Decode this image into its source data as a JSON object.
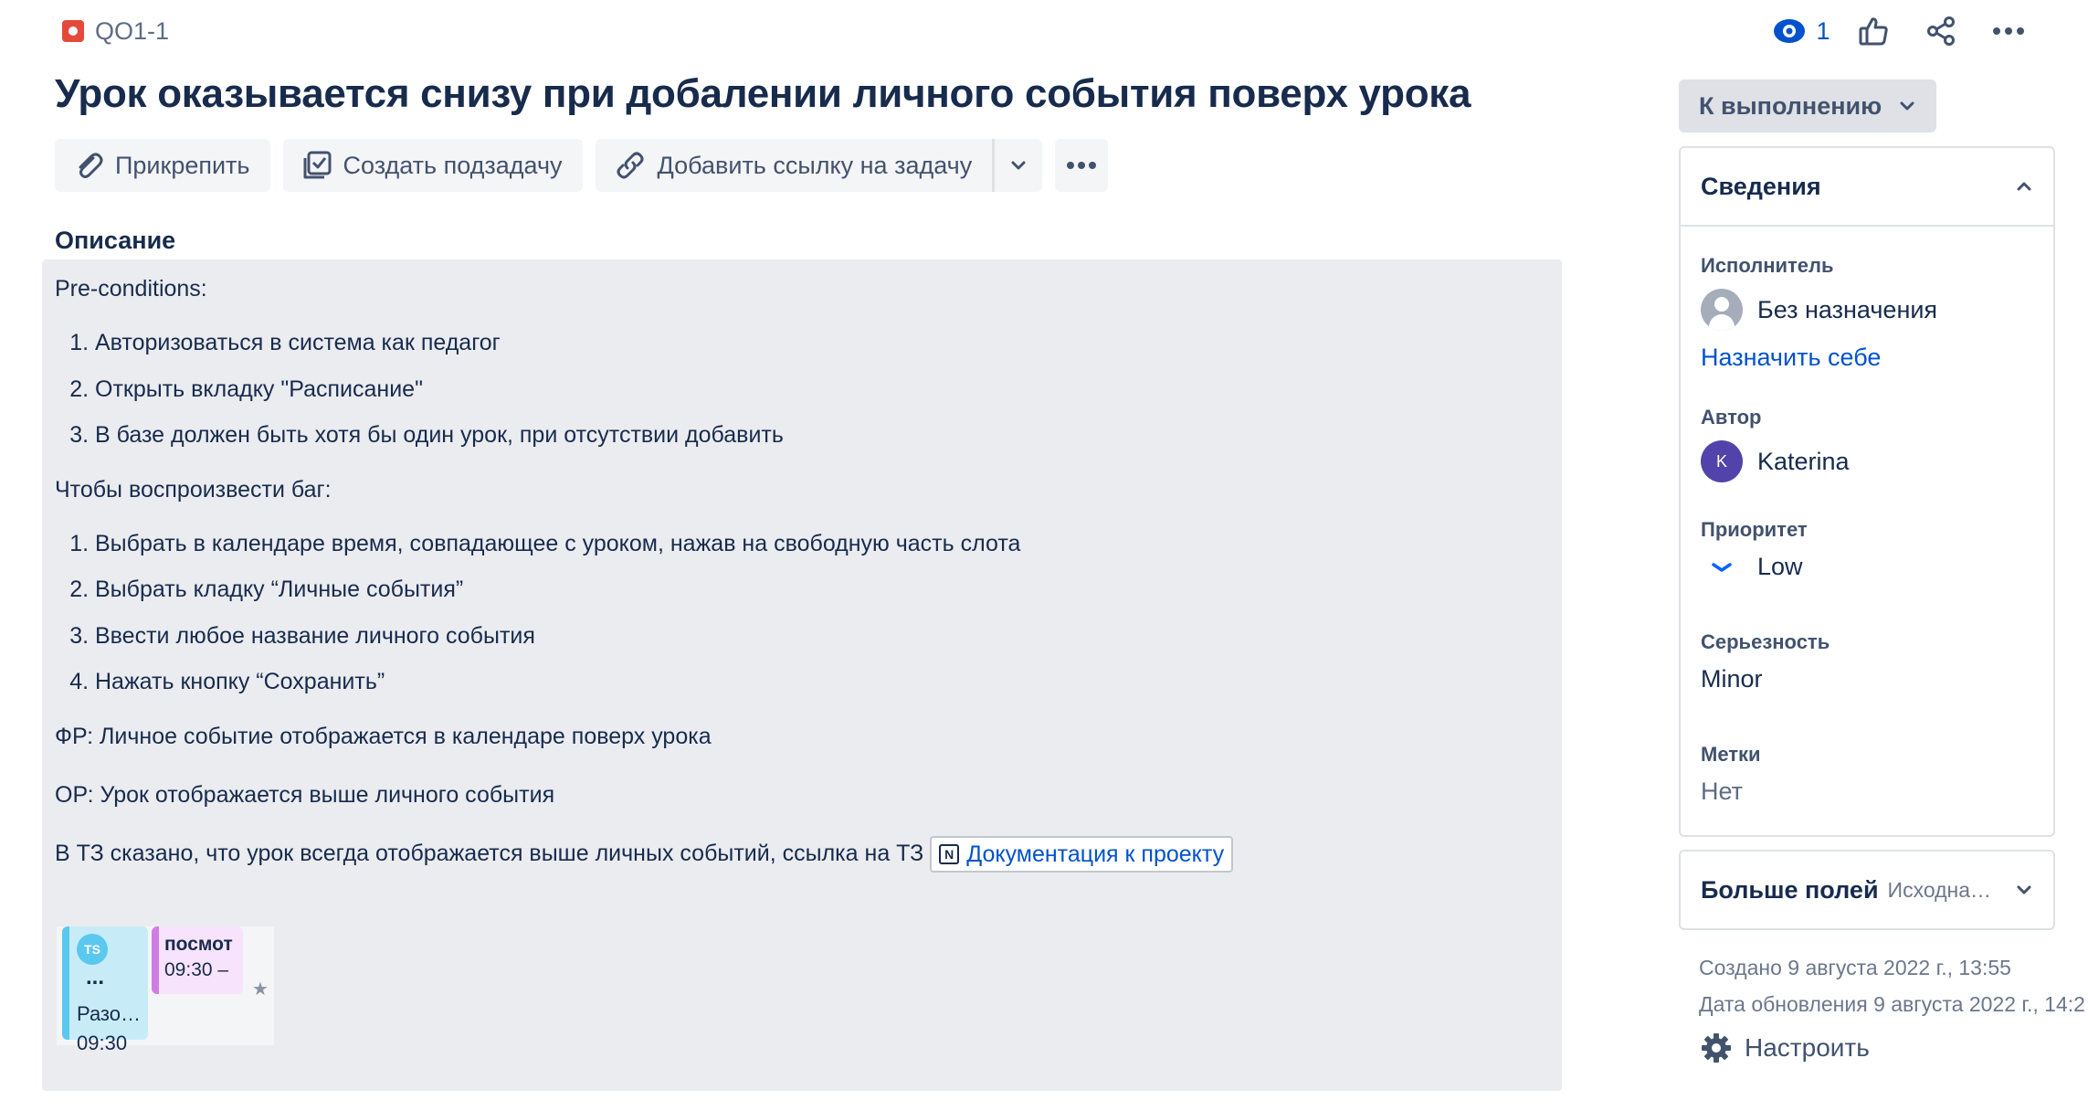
{
  "issue": {
    "key": "QO1-1",
    "title": "Урок оказывается снизу при добалении личного события поверх урока"
  },
  "top_actions": {
    "watch_count": "1"
  },
  "toolbar": {
    "attach": "Прикрепить",
    "create_subtask": "Создать подзадачу",
    "add_link": "Добавить ссылку на задачу"
  },
  "description": {
    "label": "Описание",
    "preconditions": "Pre-conditions:",
    "pre_steps": [
      "Авторизоваться в система как педагог",
      "Открыть вкладку \"Расписание\"",
      "В базе должен быть хотя бы один урок, при отсутствии добавить"
    ],
    "repro_label": "Чтобы воспроизвести баг:",
    "repro_steps": [
      "Выбрать в календаре время, совпадающее с уроком, нажав на свободную часть слота",
      "Выбрать кладку “Личные события”",
      "Ввести любое название личного события",
      "Нажать кнопку “Сохранить”"
    ],
    "actual": "ФР: Личное событие отображается в календаре поверх урока",
    "expected": "ОР: Урок отображается выше личного события",
    "spec_text": "В ТЗ сказано, что урок всегда отображается выше личных событий, ссылка на ТЗ",
    "doc_link": "Документация к проекту",
    "doc_icon": "N",
    "screenshot": {
      "event1_avatar": "TS",
      "event1_dots": "...",
      "event1_title": "Разо…",
      "event1_time": "09:30",
      "event2_title": "посмот",
      "event2_time": "09:30 –"
    }
  },
  "sidebar": {
    "status": "К выполнению",
    "details_title": "Сведения",
    "assignee_label": "Исполнитель",
    "assignee_value": "Без назначения",
    "assign_me": "Назначить себе",
    "author_label": "Автор",
    "author_initial": "K",
    "author_value": "Katerina",
    "priority_label": "Приоритет",
    "priority_value": "Low",
    "severity_label": "Серьезность",
    "severity_value": "Minor",
    "labels_label": "Метки",
    "labels_value": "Нет",
    "more_fields": "Больше полей",
    "more_fields_sub": "Исходна…",
    "created": "Создано 9 августа 2022 г., 13:55",
    "updated": "Дата обновления 9 августа 2022 г., 14:2",
    "configure": "Настроить"
  },
  "colors": {
    "issue_type": "#e5493a",
    "link": "#0052cc",
    "priority_low": "#0065ff",
    "avatar": "#5243aa"
  }
}
